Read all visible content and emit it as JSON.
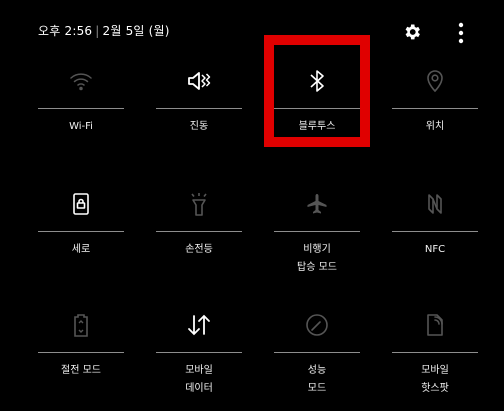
{
  "status": {
    "time": "오후 2:56",
    "separator": "|",
    "date": "2월 5일 (월)"
  },
  "header_icons": [
    "gear-icon",
    "more-vertical-icon"
  ],
  "tiles": [
    {
      "label": "Wi-Fi",
      "icon": "wifi-icon",
      "active": false
    },
    {
      "label": "진동",
      "icon": "vibrate-icon",
      "active": true
    },
    {
      "label": "블루투스",
      "icon": "bluetooth-icon",
      "active": true
    },
    {
      "label": "위치",
      "icon": "location-icon",
      "active": false
    },
    {
      "label": "세로",
      "icon": "portrait-lock-icon",
      "active": true
    },
    {
      "label": "손전등",
      "icon": "flashlight-icon",
      "active": false
    },
    {
      "label": "비행기\n탑승 모드",
      "icon": "airplane-icon",
      "active": false
    },
    {
      "label": "NFC",
      "icon": "nfc-icon",
      "active": false
    },
    {
      "label": "절전 모드",
      "icon": "battery-saver-icon",
      "active": false
    },
    {
      "label": "모바일\n데이터",
      "icon": "mobile-data-icon",
      "active": true
    },
    {
      "label": "성능\n모드",
      "icon": "performance-icon",
      "active": false
    },
    {
      "label": "모바일\n핫스팟",
      "icon": "hotspot-icon",
      "active": false
    }
  ],
  "colors": {
    "background": "#000000",
    "active_icon": "#ffffff",
    "inactive_icon": "#555555",
    "highlight": "#e00000"
  }
}
